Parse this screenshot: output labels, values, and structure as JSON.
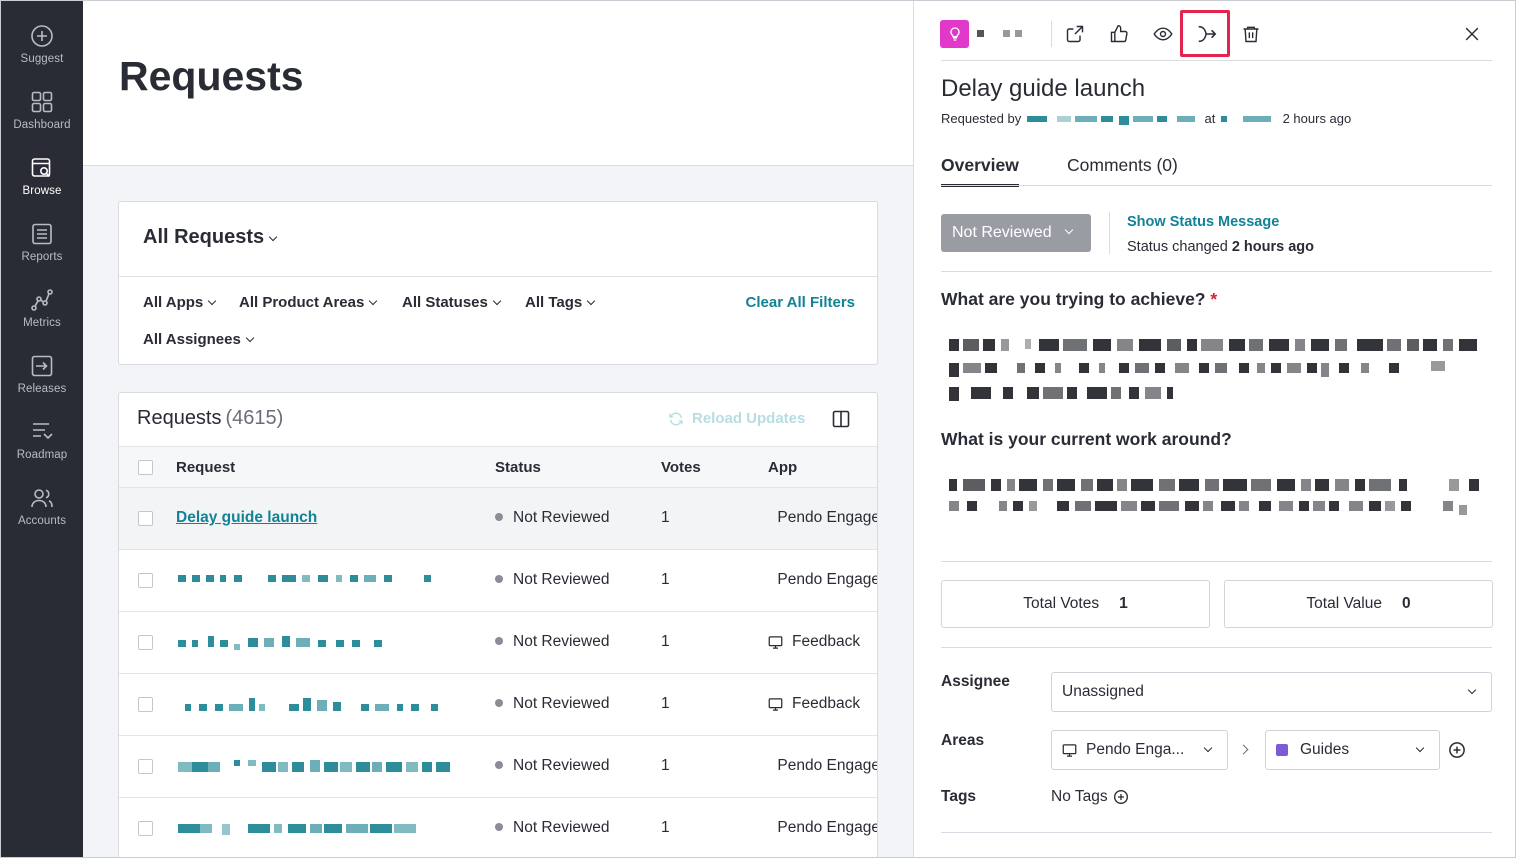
{
  "sidebar": {
    "items": [
      {
        "label": "Suggest",
        "icon": "plus-circle-icon"
      },
      {
        "label": "Dashboard",
        "icon": "grid-icon"
      },
      {
        "label": "Browse",
        "icon": "browse-search-icon",
        "active": true
      },
      {
        "label": "Reports",
        "icon": "document-list-icon"
      },
      {
        "label": "Metrics",
        "icon": "graph-nodes-icon"
      },
      {
        "label": "Releases",
        "icon": "release-arrow-icon"
      },
      {
        "label": "Roadmap",
        "icon": "roadmap-icon"
      },
      {
        "label": "Accounts",
        "icon": "users-icon"
      }
    ]
  },
  "main": {
    "title": "Requests",
    "filters": {
      "title": "All Requests",
      "items": [
        "All Apps",
        "All Product Areas",
        "All Statuses",
        "All Tags",
        "All Assignees"
      ],
      "clear_label": "Clear All Filters"
    },
    "table": {
      "title": "Requests",
      "count": "(4615)",
      "reload_label": "Reload Updates",
      "columns": [
        "Request",
        "Status",
        "Votes",
        "App"
      ],
      "rows": [
        {
          "request": "Delay guide launch",
          "status": "Not Reviewed",
          "votes": "1",
          "app": "Pendo Engage"
        },
        {
          "request": "",
          "status": "Not Reviewed",
          "votes": "1",
          "app": "Pendo Engage"
        },
        {
          "request": "",
          "status": "Not Reviewed",
          "votes": "1",
          "app": "Feedback"
        },
        {
          "request": "",
          "status": "Not Reviewed",
          "votes": "1",
          "app": "Feedback"
        },
        {
          "request": "",
          "status": "Not Reviewed",
          "votes": "1",
          "app": "Pendo Engage"
        },
        {
          "request": "",
          "status": "Not Reviewed",
          "votes": "1",
          "app": "Pendo Engage"
        }
      ]
    }
  },
  "panel": {
    "toolbar_icons": [
      "open-external-icon",
      "thumbs-up-icon",
      "eye-icon",
      "merge-icon",
      "trash-icon",
      "close-icon"
    ],
    "colors": {
      "accent": "#128297",
      "brand_badge": "#e039c9",
      "highlight": "#e2244f",
      "area_swatch": "#7e5bd6"
    },
    "title": "Delay guide launch",
    "meta": {
      "requested_by": "Requested by",
      "at": "at",
      "time": "2 hours ago"
    },
    "tabs": [
      "Overview",
      "Comments (0)"
    ],
    "status": {
      "value": "Not Reviewed",
      "show_message": "Show Status Message",
      "changed_prefix": "Status changed",
      "changed_time": "2 hours ago"
    },
    "questions": {
      "q1": "What are you trying to achieve?",
      "q1_required": "*",
      "q2": "What is your current work around?"
    },
    "stats": {
      "total_votes_label": "Total Votes",
      "total_votes": "1",
      "total_value_label": "Total Value",
      "total_value": "0"
    },
    "fields": {
      "assignee_label": "Assignee",
      "assignee_value": "Unassigned",
      "areas_label": "Areas",
      "area_app": "Pendo Enga...",
      "area_value": "Guides",
      "tags_label": "Tags",
      "tags_value": "No Tags"
    }
  }
}
